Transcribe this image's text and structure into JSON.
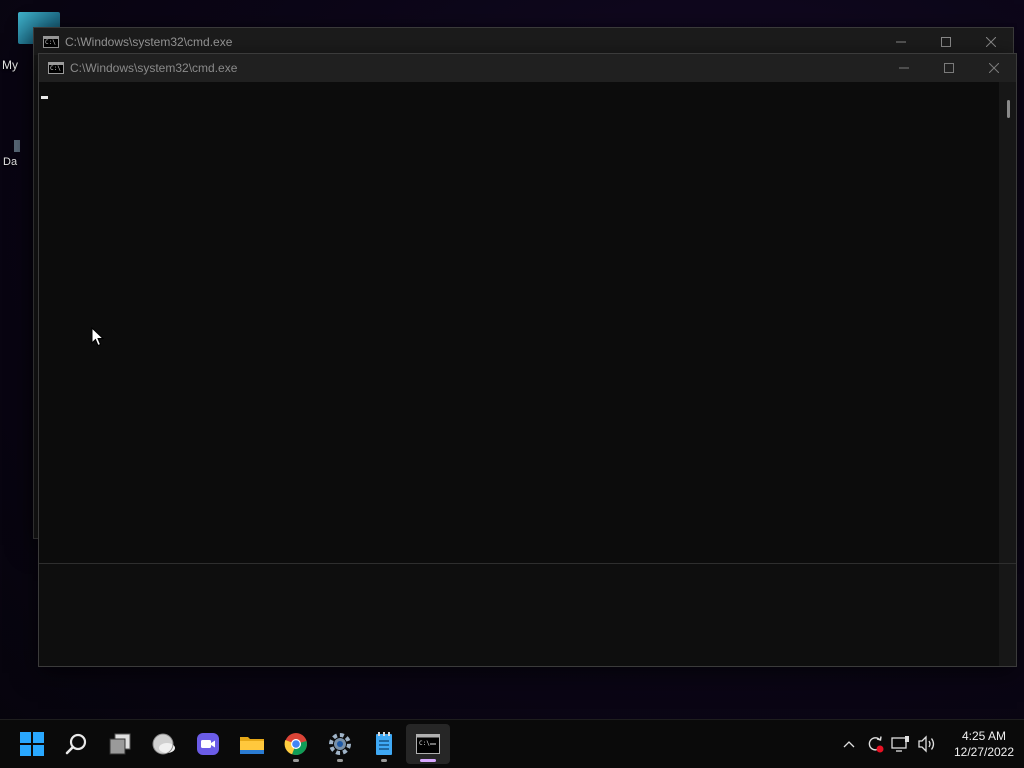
{
  "desktop": {
    "icon1_label": "My",
    "icon2_label": "Da"
  },
  "back_window": {
    "title": "C:\\Windows\\system32\\cmd.exe"
  },
  "front_window": {
    "title": "C:\\Windows\\system32\\cmd.exe"
  },
  "taskbar": {
    "apps": [
      "start",
      "search",
      "task-view",
      "onedrive",
      "meet",
      "file-explorer",
      "chrome",
      "settings",
      "notepad",
      "cmd"
    ],
    "active_app": "cmd"
  },
  "tray": {
    "time": "4:25 AM",
    "date": "12/27/2022"
  },
  "colors": {
    "accent": "#0078d4",
    "active_indicator": "#d8a8ff"
  }
}
